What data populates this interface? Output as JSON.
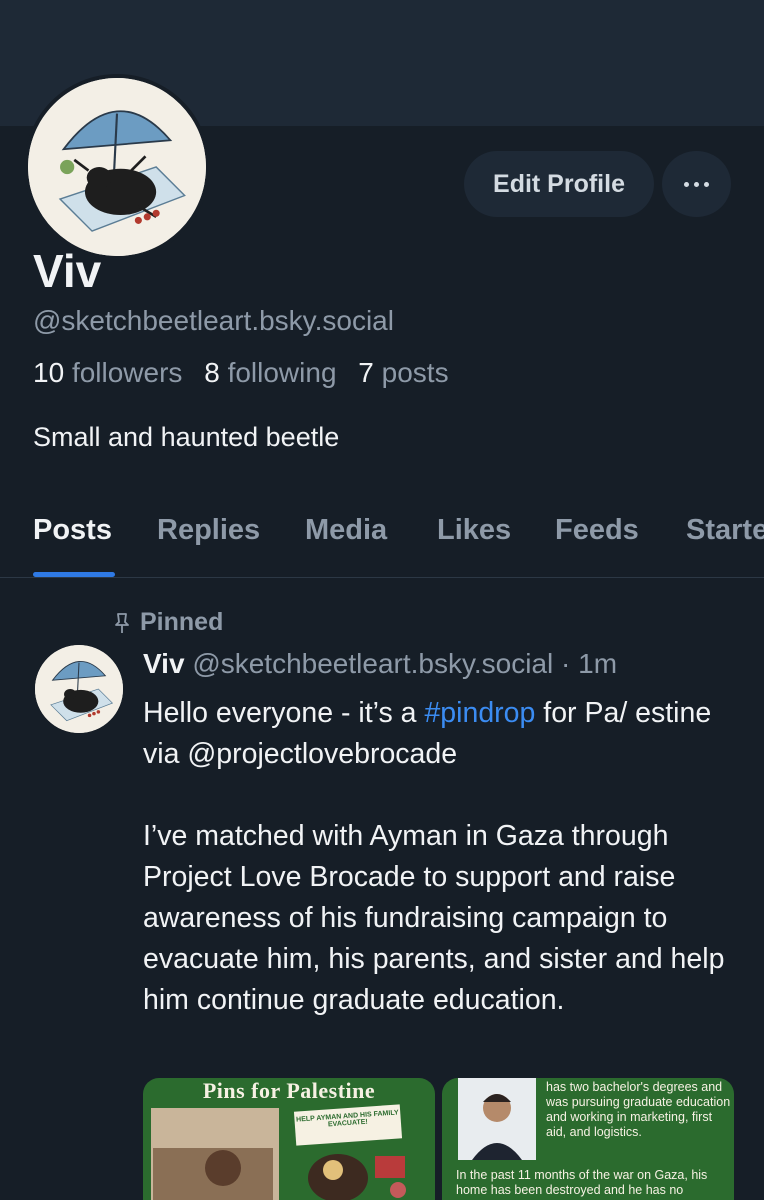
{
  "profile": {
    "display_name": "Viv",
    "handle": "@sketchbeetleart.bsky.social",
    "followers_count": "10",
    "followers_label": "followers",
    "following_count": "8",
    "following_label": "following",
    "posts_count": "7",
    "posts_label": "posts",
    "bio": "Small and haunted beetle",
    "edit_label": "Edit Profile",
    "more_icon": "ellipsis-icon"
  },
  "tabs": [
    {
      "label": "Posts",
      "active": true
    },
    {
      "label": "Replies"
    },
    {
      "label": "Media"
    },
    {
      "label": "Likes"
    },
    {
      "label": "Feeds"
    },
    {
      "label": "Starte"
    }
  ],
  "post": {
    "pinned_label": "Pinned",
    "author_name": "Viv",
    "author_handle": "@sketchbeetleart.bsky.social",
    "separator": "·",
    "time": "1m",
    "text_before_tag": "Hello everyone - it’s a ",
    "hashtag": "#pindrop",
    "text_after_tag": " for Pa/ estine via @projectlovebrocade",
    "paragraph2": "I’ve matched with Ayman in Gaza through Project Love Brocade to support and raise awareness of his fundraising campaign to evacuate him, his parents, and sister and help him continue graduate education.",
    "images": [
      {
        "title": "Pins for Palestine",
        "note": "HELP AYMAN AND HIS FAMILY EVACUATE!"
      },
      {
        "text_top": "has two bachelor's degrees and was pursuing graduate education and working in marketing, first aid, and logistics.",
        "text_bottom": "In the past 11 months of the war on Gaza, his home has been destroyed and he has no"
      }
    ]
  },
  "colors": {
    "background": "#161e27",
    "banner": "#1e2936",
    "accent": "#2f7ae5",
    "hashtag": "#3b8cf2",
    "muted_text": "#8e9aa8"
  }
}
